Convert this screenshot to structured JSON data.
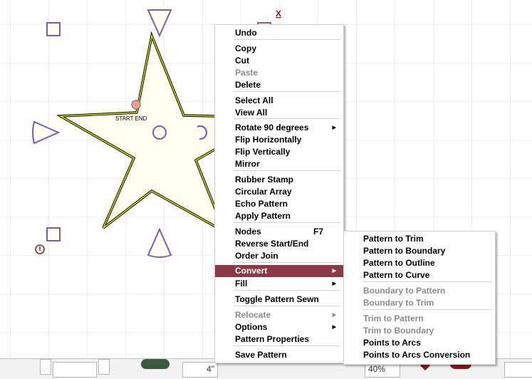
{
  "canvas": {
    "close_label": "X",
    "start_end_label": "START END"
  },
  "context_menu": {
    "items": [
      {
        "label": "Undo",
        "state": "normal"
      },
      {
        "label": "Copy",
        "state": "normal"
      },
      {
        "label": "Cut",
        "state": "normal"
      },
      {
        "label": "Paste",
        "state": "disabled"
      },
      {
        "label": "Delete",
        "state": "normal"
      },
      {
        "label": "Select All",
        "state": "normal"
      },
      {
        "label": "View All",
        "state": "normal"
      },
      {
        "label": "Rotate 90 degrees",
        "state": "normal",
        "submenu": true
      },
      {
        "label": "Flip Horizontally",
        "state": "normal"
      },
      {
        "label": "Flip Vertically",
        "state": "normal"
      },
      {
        "label": "Mirror",
        "state": "normal"
      },
      {
        "label": "Rubber Stamp",
        "state": "normal"
      },
      {
        "label": "Circular Array",
        "state": "normal"
      },
      {
        "label": "Echo Pattern",
        "state": "normal"
      },
      {
        "label": "Apply Pattern",
        "state": "normal"
      },
      {
        "label": "Nodes",
        "state": "normal",
        "shortcut": "F7"
      },
      {
        "label": "Reverse Start/End",
        "state": "normal"
      },
      {
        "label": "Order Join",
        "state": "normal"
      },
      {
        "label": "Convert",
        "state": "active",
        "submenu": true
      },
      {
        "label": "Fill",
        "state": "normal",
        "submenu": true
      },
      {
        "label": "Toggle Pattern Sewn",
        "state": "normal"
      },
      {
        "label": "Relocate",
        "state": "disabled",
        "submenu": true
      },
      {
        "label": "Options",
        "state": "normal",
        "submenu": true
      },
      {
        "label": "Pattern Properties",
        "state": "normal"
      },
      {
        "label": "Save Pattern",
        "state": "normal"
      }
    ]
  },
  "convert_submenu": {
    "items": [
      {
        "label": "Pattern to Trim",
        "state": "normal"
      },
      {
        "label": "Pattern to Boundary",
        "state": "normal"
      },
      {
        "label": "Pattern to Outline",
        "state": "normal"
      },
      {
        "label": "Pattern to Curve",
        "state": "normal"
      },
      {
        "label": "Boundary to Pattern",
        "state": "disabled"
      },
      {
        "label": "Boundary to Trim",
        "state": "disabled"
      },
      {
        "label": "Trim to Pattern",
        "state": "disabled"
      },
      {
        "label": "Trim to Boundary",
        "state": "disabled"
      },
      {
        "label": "Points to Arcs",
        "state": "normal"
      },
      {
        "label": "Points to Arcs Conversion",
        "state": "normal"
      }
    ]
  },
  "bottom_bar": {
    "size_value": "4\"",
    "zoom_value": "40%"
  },
  "colors": {
    "handle": "#7b5cae",
    "star_fill": "#fffff0",
    "star_stroke": "#d8d800",
    "menu_highlight": "#8b3a45",
    "marker_red": "#8b1a1a"
  }
}
